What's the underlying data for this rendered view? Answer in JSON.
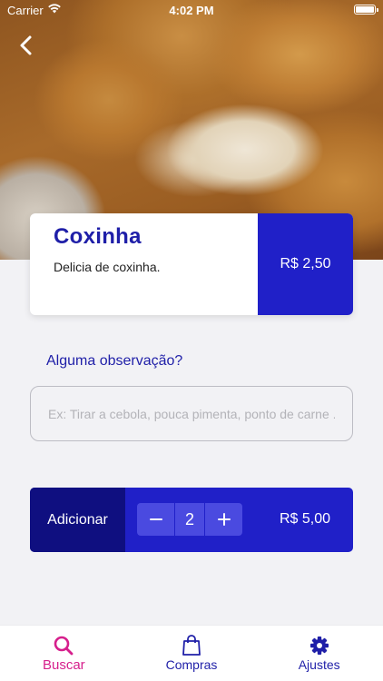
{
  "status_bar": {
    "carrier": "Carrier",
    "time": "4:02 PM"
  },
  "product": {
    "name": "Coxinha",
    "description": "Delicia de coxinha.",
    "price": "R$ 2,50"
  },
  "observation": {
    "label": "Alguma observação?",
    "placeholder": "Ex: Tirar a cebola, pouca pimenta, ponto de carne ...",
    "value": ""
  },
  "order": {
    "add_label": "Adicionar",
    "quantity": "2",
    "total": "R$ 5,00"
  },
  "tab_bar": {
    "tabs": [
      {
        "label": "Buscar",
        "icon": "search-icon",
        "active": true
      },
      {
        "label": "Compras",
        "icon": "shopping-bag-icon",
        "active": false
      },
      {
        "label": "Ajustes",
        "icon": "gear-icon",
        "active": false
      }
    ]
  },
  "colors": {
    "primary": "#2020c8",
    "primary_dark": "#0f0f80",
    "accent": "#d61f8c",
    "text_blue": "#1f1fa8"
  }
}
